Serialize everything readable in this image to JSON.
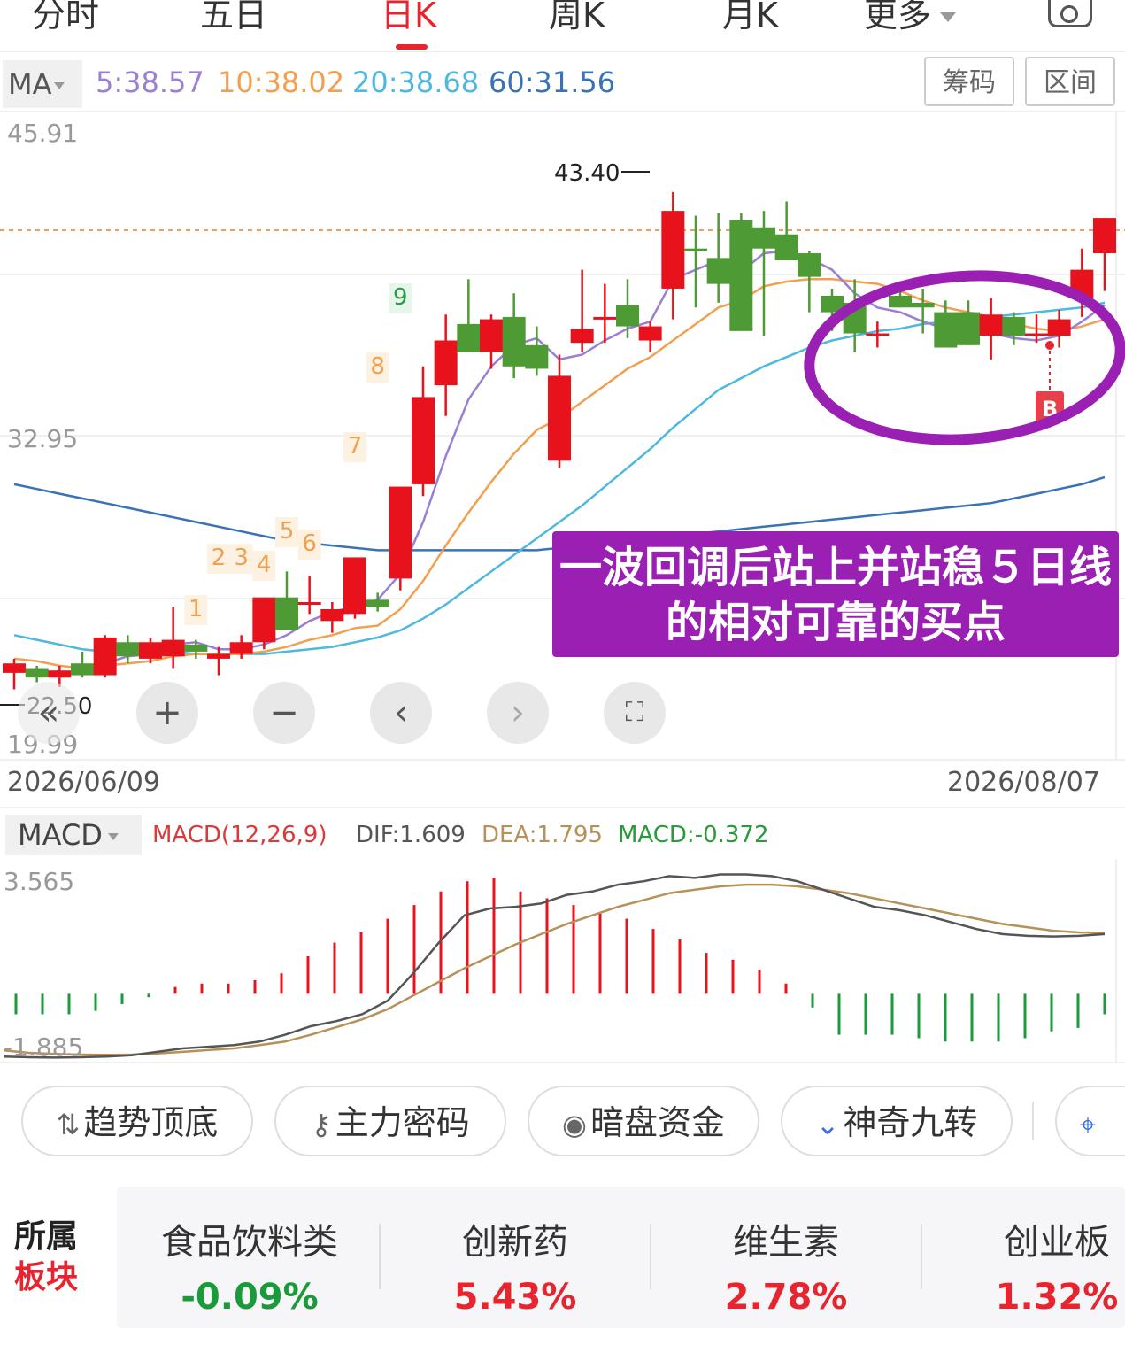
{
  "tabs": [
    "分时",
    "五日",
    "日K",
    "周K",
    "月K",
    "更多"
  ],
  "active_tab": "日K",
  "icons": {
    "more_caret": "chevron-down-icon",
    "settings": "settings-icon"
  },
  "ma": {
    "selector": "MA",
    "values": [
      {
        "label": "5:38.57",
        "color": "#9b7fd4"
      },
      {
        "label": "10:38.02",
        "color": "#f0a050"
      },
      {
        "label": "20:38.68",
        "color": "#4fb8e0"
      },
      {
        "label": "60:31.56",
        "color": "#3a72b8"
      }
    ]
  },
  "buttons": {
    "chip": "筹码",
    "range": "区间"
  },
  "price_axis": {
    "top": "45.91",
    "mid": "32.95",
    "bottom": "19.99"
  },
  "price_marks": {
    "high": "43.40",
    "low": "22.50"
  },
  "signal_marker": "B",
  "countdown_labels": [
    "1",
    "2",
    "3",
    "4",
    "5",
    "6",
    "7",
    "8",
    "9"
  ],
  "annotation": "一波回调后站上并站稳５日线的相对可靠的买点",
  "dates": {
    "start": "2026/06/09",
    "end": "2026/08/07"
  },
  "macd": {
    "selector": "MACD",
    "params": "MACD(12,26,9)",
    "dif": "DIF:1.609",
    "dea": "DEA:1.795",
    "macd": "MACD:-0.372",
    "axis_top": "3.565",
    "axis_bottom": "-1.885"
  },
  "tools": [
    "趋势顶底",
    "主力密码",
    "暗盘资金",
    "神奇九转"
  ],
  "sectors": {
    "heading_line1": "所属",
    "heading_line2": "板块",
    "items": [
      {
        "name": "食品饮料类",
        "value": "-0.09%",
        "color": "#1a9a3a"
      },
      {
        "name": "创新药",
        "value": "5.43%",
        "color": "#e8242e"
      },
      {
        "name": "维生素",
        "value": "2.78%",
        "color": "#e8242e"
      },
      {
        "name": "创业板",
        "value": "1.32%",
        "color": "#e8242e"
      }
    ]
  },
  "chart_data": {
    "type": "candlestick",
    "y_range": [
      19.99,
      45.91
    ],
    "ohlc": [
      [
        23.0,
        23.6,
        22.3,
        23.4
      ],
      [
        23.2,
        23.3,
        22.6,
        22.8
      ],
      [
        22.8,
        23.3,
        22.4,
        23.1
      ],
      [
        23.4,
        23.9,
        22.8,
        22.9
      ],
      [
        22.9,
        24.6,
        22.8,
        24.5
      ],
      [
        24.3,
        24.6,
        23.4,
        23.7
      ],
      [
        23.6,
        24.5,
        23.4,
        24.3
      ],
      [
        23.7,
        25.8,
        23.2,
        24.4
      ],
      [
        24.2,
        24.4,
        23.6,
        23.9
      ],
      [
        23.6,
        24.1,
        22.9,
        23.8
      ],
      [
        23.8,
        24.6,
        23.6,
        24.3
      ],
      [
        24.3,
        25.7,
        24.0,
        26.2
      ],
      [
        26.2,
        27.3,
        24.9,
        24.8
      ],
      [
        26.0,
        27.1,
        25.5,
        26.0
      ],
      [
        25.2,
        26.0,
        24.7,
        25.7
      ],
      [
        25.5,
        27.8,
        25.3,
        27.9
      ],
      [
        26.1,
        26.4,
        25.6,
        25.8
      ],
      [
        27.0,
        30.4,
        26.5,
        30.9
      ],
      [
        31.0,
        36.0,
        30.5,
        34.7
      ],
      [
        35.2,
        38.2,
        33.9,
        37.1
      ],
      [
        37.8,
        39.7,
        37.1,
        36.6
      ],
      [
        36.6,
        38.2,
        35.9,
        38.0
      ],
      [
        38.1,
        39.1,
        35.5,
        36.0
      ],
      [
        36.9,
        37.7,
        35.6,
        35.9
      ],
      [
        32.0,
        36.5,
        31.7,
        35.6
      ],
      [
        37.0,
        40.1,
        36.6,
        37.6
      ],
      [
        38.1,
        39.5,
        37.0,
        38.1
      ],
      [
        38.6,
        39.7,
        37.2,
        37.7
      ],
      [
        37.1,
        37.9,
        36.6,
        37.7
      ],
      [
        39.3,
        43.4,
        38.0,
        42.6
      ],
      [
        41.0,
        42.4,
        38.5,
        40.9
      ],
      [
        40.6,
        42.5,
        38.7,
        39.5
      ],
      [
        42.2,
        42.5,
        37.9,
        37.5
      ],
      [
        41.9,
        42.6,
        37.3,
        41.0
      ],
      [
        41.6,
        43.0,
        40.8,
        40.5
      ],
      [
        40.8,
        40.9,
        38.3,
        39.8
      ],
      [
        39.0,
        39.3,
        37.5,
        38.3
      ],
      [
        38.7,
        39.7,
        36.6,
        37.4
      ],
      [
        37.3,
        37.9,
        36.8,
        37.4
      ],
      [
        39.0,
        39.6,
        38.5,
        38.5
      ],
      [
        38.7,
        39.3,
        37.4,
        38.5
      ],
      [
        38.3,
        38.8,
        37.4,
        36.8
      ],
      [
        38.3,
        38.8,
        36.9,
        36.9
      ],
      [
        37.3,
        38.9,
        36.3,
        38.2
      ],
      [
        38.1,
        38.3,
        36.9,
        37.3
      ],
      [
        37.3,
        38.2,
        37.0,
        37.4
      ],
      [
        37.3,
        38.4,
        36.8,
        38.0
      ],
      [
        38.9,
        41.0,
        38.1,
        40.1
      ],
      [
        40.8,
        42.3,
        39.2,
        42.3
      ]
    ],
    "ma5": [
      23.2,
      23.0,
      22.9,
      23.0,
      23.4,
      23.7,
      23.8,
      24.2,
      24.3,
      24.0,
      24.0,
      24.2,
      24.6,
      25.2,
      25.6,
      25.8,
      26.1,
      27.2,
      29.4,
      32.2,
      34.6,
      36.0,
      36.9,
      37.2,
      36.3,
      36.5,
      37.1,
      37.6,
      37.9,
      39.7,
      40.1,
      40.5,
      40.0,
      40.8,
      40.9,
      40.6,
      40.1,
      39.1,
      38.5,
      38.3,
      37.9,
      37.6,
      37.4,
      37.4,
      37.2,
      37.1,
      37.3,
      37.9,
      38.6
    ],
    "ma10": [
      23.6,
      23.5,
      23.3,
      23.2,
      23.3,
      23.4,
      23.5,
      23.7,
      23.8,
      23.8,
      23.8,
      23.9,
      24.1,
      24.4,
      24.6,
      24.9,
      25.0,
      25.7,
      26.9,
      28.4,
      29.8,
      31.1,
      32.3,
      33.3,
      33.8,
      34.5,
      35.2,
      35.9,
      36.4,
      37.1,
      37.8,
      38.5,
      38.8,
      39.4,
      39.6,
      39.7,
      39.7,
      39.6,
      39.5,
      39.2,
      38.8,
      38.5,
      38.3,
      38.1,
      37.8,
      37.6,
      37.5,
      37.7,
      38.0
    ],
    "ma20": [
      24.6,
      24.4,
      24.2,
      24.0,
      23.9,
      23.9,
      23.9,
      23.9,
      23.8,
      23.8,
      23.8,
      23.8,
      23.9,
      24.0,
      24.1,
      24.3,
      24.5,
      24.8,
      25.3,
      25.9,
      26.6,
      27.3,
      28.0,
      28.7,
      29.4,
      30.1,
      30.9,
      31.7,
      32.5,
      33.4,
      34.2,
      35.0,
      35.5,
      36.0,
      36.4,
      36.8,
      37.1,
      37.3,
      37.5,
      37.6,
      37.8,
      37.9,
      38.0,
      38.1,
      38.2,
      38.3,
      38.4,
      38.5,
      38.7
    ],
    "ma60": [
      31.0,
      30.8,
      30.6,
      30.4,
      30.2,
      30.0,
      29.8,
      29.6,
      29.4,
      29.2,
      29.0,
      28.8,
      28.6,
      28.5,
      28.4,
      28.3,
      28.2,
      28.2,
      28.2,
      28.2,
      28.2,
      28.2,
      28.2,
      28.2,
      28.3,
      28.4,
      28.5,
      28.6,
      28.7,
      28.8,
      28.9,
      29.0,
      29.1,
      29.2,
      29.3,
      29.4,
      29.5,
      29.6,
      29.7,
      29.8,
      29.9,
      30.0,
      30.1,
      30.2,
      30.4,
      30.6,
      30.8,
      31.0,
      31.3
    ],
    "macd_hist": [
      -0.6,
      -0.6,
      -0.6,
      -0.5,
      -0.3,
      -0.1,
      0.2,
      0.3,
      0.3,
      0.4,
      0.6,
      1.1,
      1.5,
      1.8,
      2.2,
      2.6,
      3.0,
      3.3,
      3.4,
      3.0,
      2.8,
      2.6,
      2.4,
      2.2,
      1.9,
      1.6,
      1.2,
      1.0,
      0.7,
      0.3,
      -0.4,
      -1.2,
      -1.2,
      -1.2,
      -1.3,
      -1.4,
      -1.4,
      -1.4,
      -1.3,
      -1.1,
      -1.0,
      -0.6
    ],
    "dif": [
      -1.84,
      -1.86,
      -1.87,
      -1.86,
      -1.84,
      -1.8,
      -1.7,
      -1.6,
      -1.55,
      -1.5,
      -1.4,
      -1.2,
      -0.95,
      -0.8,
      -0.6,
      -0.2,
      0.6,
      1.5,
      2.3,
      2.5,
      2.55,
      2.65,
      2.9,
      3.0,
      3.2,
      3.3,
      3.45,
      3.4,
      3.5,
      3.5,
      3.45,
      3.3,
      3.05,
      2.8,
      2.55,
      2.45,
      2.3,
      2.1,
      1.9,
      1.75,
      1.7,
      1.68,
      1.7,
      1.75
    ],
    "dea": [
      -1.66,
      -1.73,
      -1.76,
      -1.78,
      -1.79,
      -1.78,
      -1.75,
      -1.7,
      -1.65,
      -1.6,
      -1.5,
      -1.4,
      -1.2,
      -0.98,
      -0.75,
      -0.45,
      -0.05,
      0.35,
      0.75,
      1.1,
      1.45,
      1.75,
      2.05,
      2.3,
      2.55,
      2.75,
      2.95,
      3.05,
      3.15,
      3.2,
      3.2,
      3.15,
      3.05,
      2.95,
      2.8,
      2.65,
      2.5,
      2.35,
      2.2,
      2.05,
      1.95,
      1.85,
      1.8,
      1.79
    ],
    "macd_range": [
      -1.885,
      3.565
    ]
  }
}
